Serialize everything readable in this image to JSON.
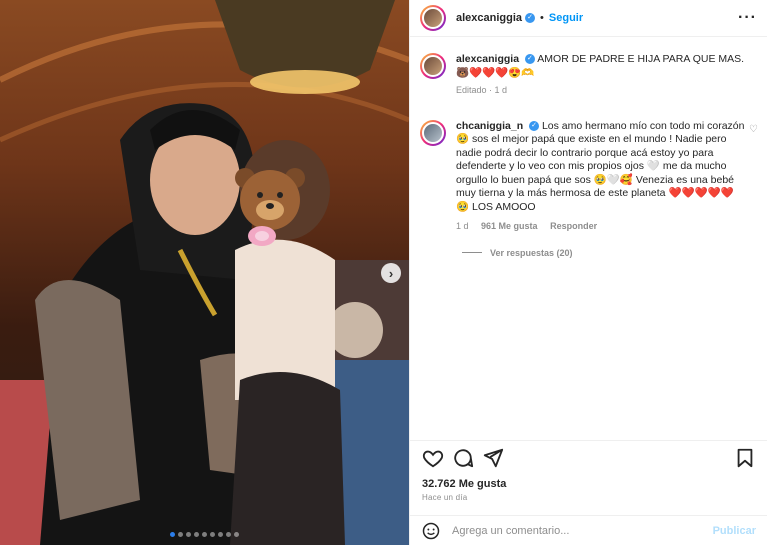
{
  "post": {
    "username": "alexcaniggia",
    "follow_label": "Seguir",
    "caption": "AMOR DE PADRE E HIJA PARA QUE MAS.",
    "caption_emojis": "🐻❤️❤️❤️😍🫶",
    "caption_meta": "Editado · 1 d",
    "likes": "32.762 Me gusta",
    "time_ago": "Hace un día"
  },
  "comment": {
    "username": "chcaniggia_n",
    "text": "Los amo hermano mío con todo mi corazón 🥹 sos el mejor papá que existe en el mundo ! Nadie pero nadie podrá decir lo contrario porque acá estoy yo para defenderte y lo veo con mis propios ojos 🤍 me da mucho orgullo lo buen papá que sos 🥹🤍🥰 Venezia es una bebé muy tierna y la más hermosa de este planeta ❤️❤️❤️❤️❤️🥹 LOS AMOOO",
    "time": "1 d",
    "likes": "961 Me gusta",
    "reply_label": "Responder",
    "view_replies": "Ver respuestas (20)"
  },
  "add_comment": {
    "placeholder": "Agrega un comentario...",
    "publish_label": "Publicar"
  },
  "carousel": {
    "total_slides": 9,
    "active_index": 0
  },
  "icons": {
    "like": "heart-icon",
    "comment": "comment-icon",
    "share": "share-icon",
    "save": "bookmark-icon",
    "emoji": "emoji-icon",
    "more": "more-icon",
    "next": "chevron-right-icon"
  },
  "colors": {
    "accent": "#0095f6",
    "verified": "#3897f0",
    "muted": "#8e8e8e",
    "publish_disabled": "#b2dffc",
    "carousel_active": "#2b7de9"
  }
}
